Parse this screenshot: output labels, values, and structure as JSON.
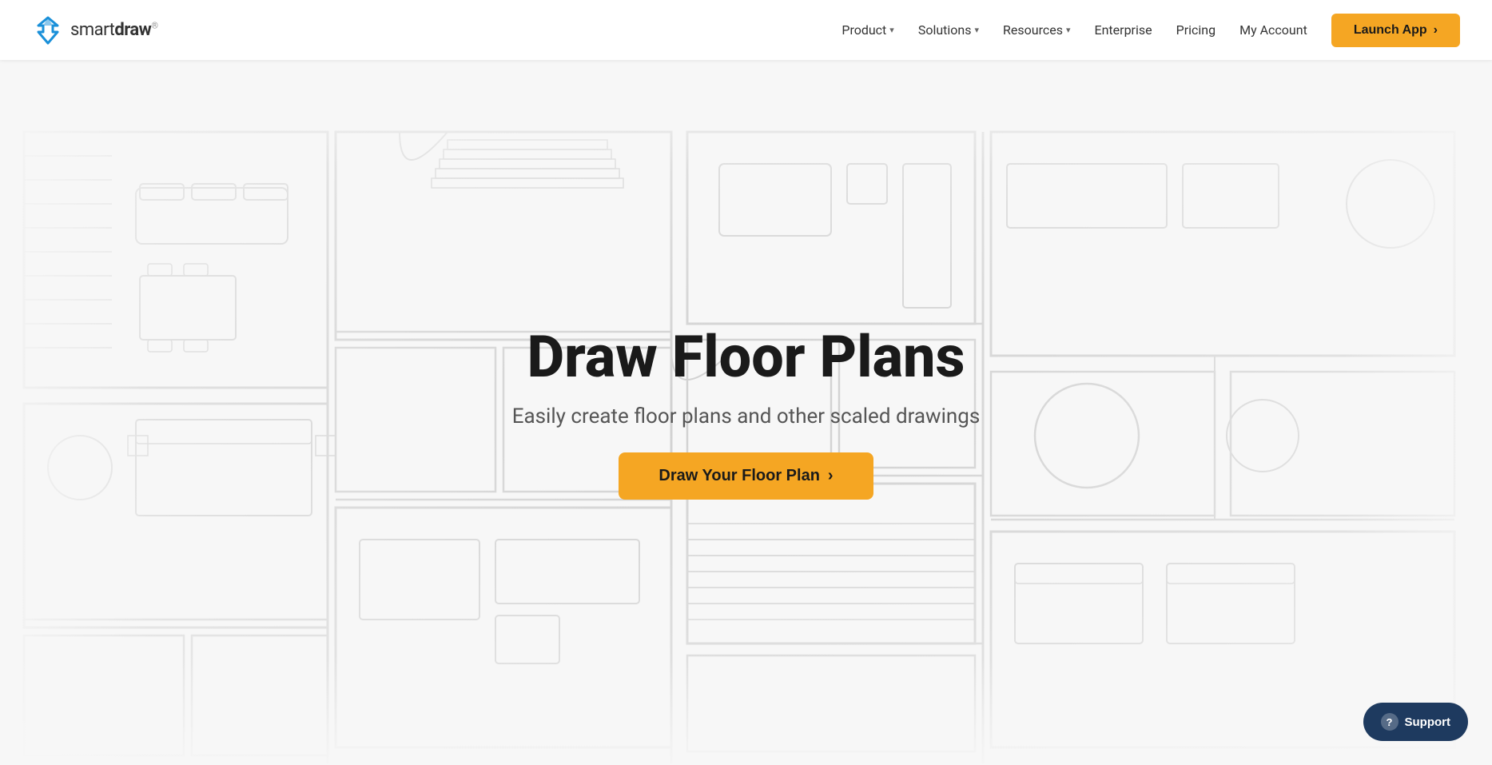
{
  "logo": {
    "name_light": "smart",
    "name_bold": "draw",
    "trademark": "®",
    "icon_color_blue": "#1a90d9",
    "icon_color_dark": "#2d4a6e"
  },
  "navbar": {
    "product_label": "Product",
    "solutions_label": "Solutions",
    "resources_label": "Resources",
    "enterprise_label": "Enterprise",
    "pricing_label": "Pricing",
    "my_account_label": "My Account",
    "launch_app_label": "Launch App",
    "launch_app_arrow": "›"
  },
  "hero": {
    "title": "Draw Floor Plans",
    "subtitle": "Easily create floor plans and other scaled drawings",
    "cta_label": "Draw Your Floor Plan",
    "cta_arrow": "›"
  },
  "support": {
    "label": "Support",
    "icon": "?"
  }
}
